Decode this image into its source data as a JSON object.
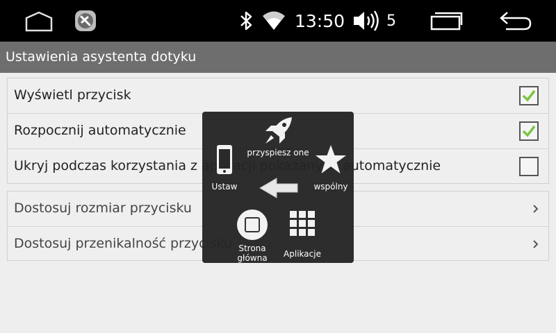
{
  "status_bar": {
    "time": "13:50",
    "volume_level": "5",
    "icons": [
      "home-icon",
      "app-icon",
      "bluetooth-icon",
      "wifi-icon",
      "volume-icon",
      "recent-apps-icon",
      "back-icon"
    ]
  },
  "title": "Ustawienia asystenta dotyku",
  "settings": {
    "toggles": [
      {
        "label": "Wyświetl przycisk",
        "checked": true
      },
      {
        "label": "Rozpocznij automatycznie",
        "checked": true
      },
      {
        "label": "Ukryj podczas korzystania z aplikacji pokazanych automatycznie",
        "checked": false
      }
    ],
    "links": [
      {
        "label": "Dostosuj rozmiar przycisku"
      },
      {
        "label": "Dostosuj przenikalność przycisku"
      }
    ]
  },
  "touch_menu": {
    "boost": "przyspiesz one",
    "settings": "Ustaw",
    "favorite": "wspólny",
    "home": "Strona główna",
    "apps": "Aplikacje"
  },
  "colors": {
    "check": "#7cc443",
    "status_bar": "#000000",
    "title_bar": "#6e6e6e",
    "menu_bg": "#242424"
  }
}
